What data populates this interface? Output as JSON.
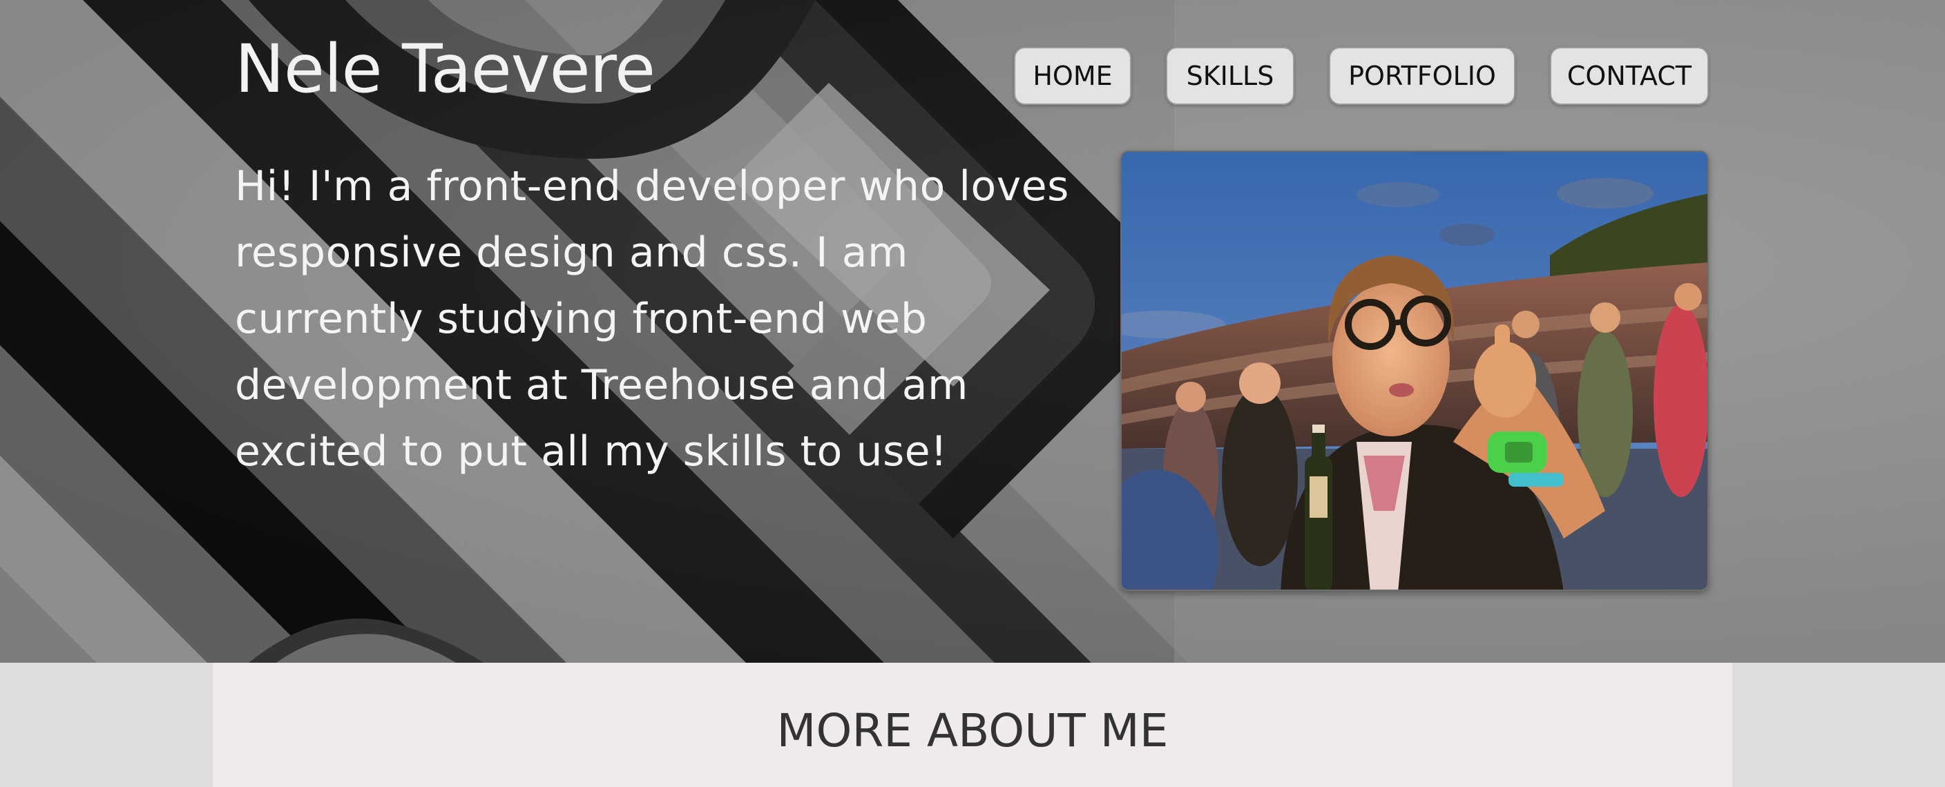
{
  "header": {
    "site_title": "Nele Taevere"
  },
  "nav": {
    "items": [
      {
        "label": "HOME"
      },
      {
        "label": "SKILLS"
      },
      {
        "label": "PORTFOLIO"
      },
      {
        "label": "CONTACT"
      }
    ]
  },
  "intro": {
    "text": "Hi! I'm a front-end developer who loves responsive design and css. I am currently studying front-end web development at Treehouse and am excited to put all my skills to use!"
  },
  "photo": {
    "icon": "profile-photo"
  },
  "about": {
    "heading": "MORE ABOUT ME"
  },
  "colors": {
    "nav_button_bg": "#e3e3e3",
    "hero_text": "#f4f4f4",
    "about_bg": "#efebeb",
    "page_bg": "#dedcdc"
  }
}
